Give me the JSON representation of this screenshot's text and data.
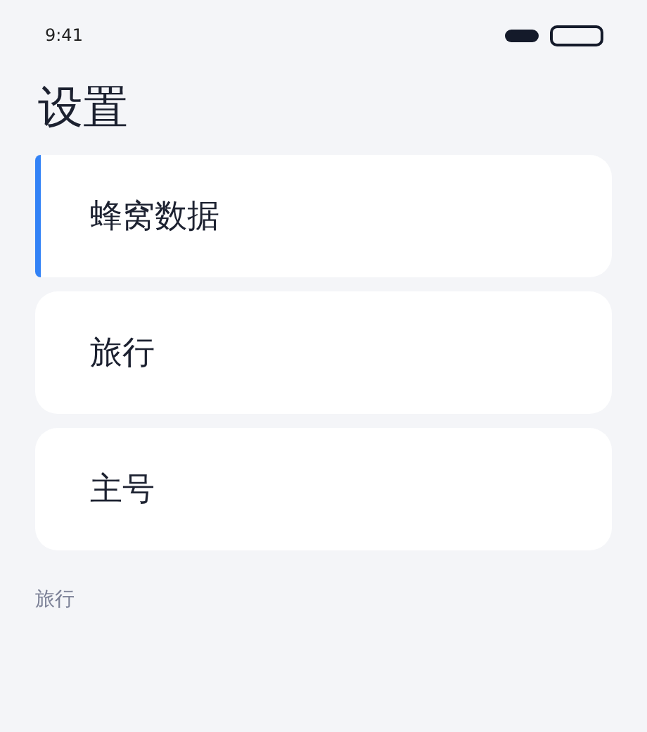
{
  "status_bar": {
    "time": "9:41"
  },
  "title": "设置",
  "items": [
    {
      "label": "蜂窝数据",
      "selected": true
    },
    {
      "label": "旅行",
      "selected": false
    },
    {
      "label": "主号",
      "selected": false
    }
  ],
  "footer": "旅行"
}
